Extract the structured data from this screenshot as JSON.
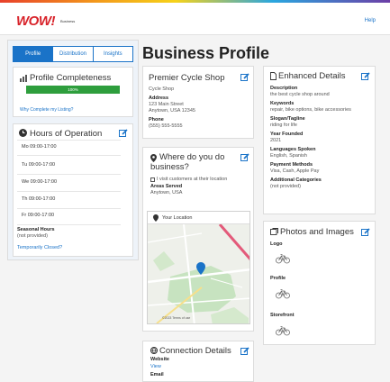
{
  "header": {
    "logo": "WOW!",
    "logo_sub": "Business",
    "help": "Help"
  },
  "tabs": [
    {
      "label": "Profile",
      "active": true
    },
    {
      "label": "Distribution",
      "active": false
    },
    {
      "label": "Insights",
      "active": false
    }
  ],
  "page_title": "Business Profile",
  "completeness": {
    "title": "Profile Completeness",
    "percent_label": "100%",
    "value": 100,
    "link": "Why Complete my Listing?",
    "bar_color": "#2e9e3d"
  },
  "hours": {
    "title": "Hours of Operation",
    "rows": [
      "Mo 09:00-17:00",
      "Tu 09:00-17:00",
      "We 09:00-17:00",
      "Th 09:00-17:00",
      "Fr 09:00-17:00"
    ],
    "seasonal_label": "Seasonal Hours",
    "seasonal_value": "(not provided)",
    "temp_closed": "Temporarily Closed?"
  },
  "business": {
    "name": "Premier Cycle Shop",
    "category": "Cycle Shop",
    "address_label": "Address",
    "address_line1": "123 Main Street",
    "address_line2": "Anytown, USA 12345",
    "phone_label": "Phone",
    "phone": "(555) 555-5555"
  },
  "where": {
    "title_line1": "Where do you do",
    "title_line2": "business?",
    "visit": "I visit customers at their location",
    "areas_label": "Areas Served",
    "areas_value": "Anytown, USA",
    "map_title": "Your Location",
    "map_attrib": "©2023 Terms of use"
  },
  "connection": {
    "title": "Connection Details",
    "website_label": "Website",
    "website_link": "View",
    "email_label": "Email"
  },
  "enhanced": {
    "title": "Enhanced Details",
    "items": [
      {
        "label": "Description",
        "value": "the best cycle shop around"
      },
      {
        "label": "Keywords",
        "value": "repair, bike options, bike accessories"
      },
      {
        "label": "Slogan/Tagline",
        "value": "riding for life"
      },
      {
        "label": "Year Founded",
        "value": "2021"
      },
      {
        "label": "Languages Spoken",
        "value": "English, Spanish"
      },
      {
        "label": "Payment Methods",
        "value": "Visa, Cash, Apple Pay"
      },
      {
        "label": "Additional Categories",
        "value": "(not provided)"
      }
    ]
  },
  "photos": {
    "title": "Photos and Images",
    "items": [
      "Logo",
      "Profile",
      "Storefront"
    ]
  },
  "colors": {
    "accent": "#1a73c8",
    "success": "#2e9e3d",
    "brand": "#d8232a"
  }
}
